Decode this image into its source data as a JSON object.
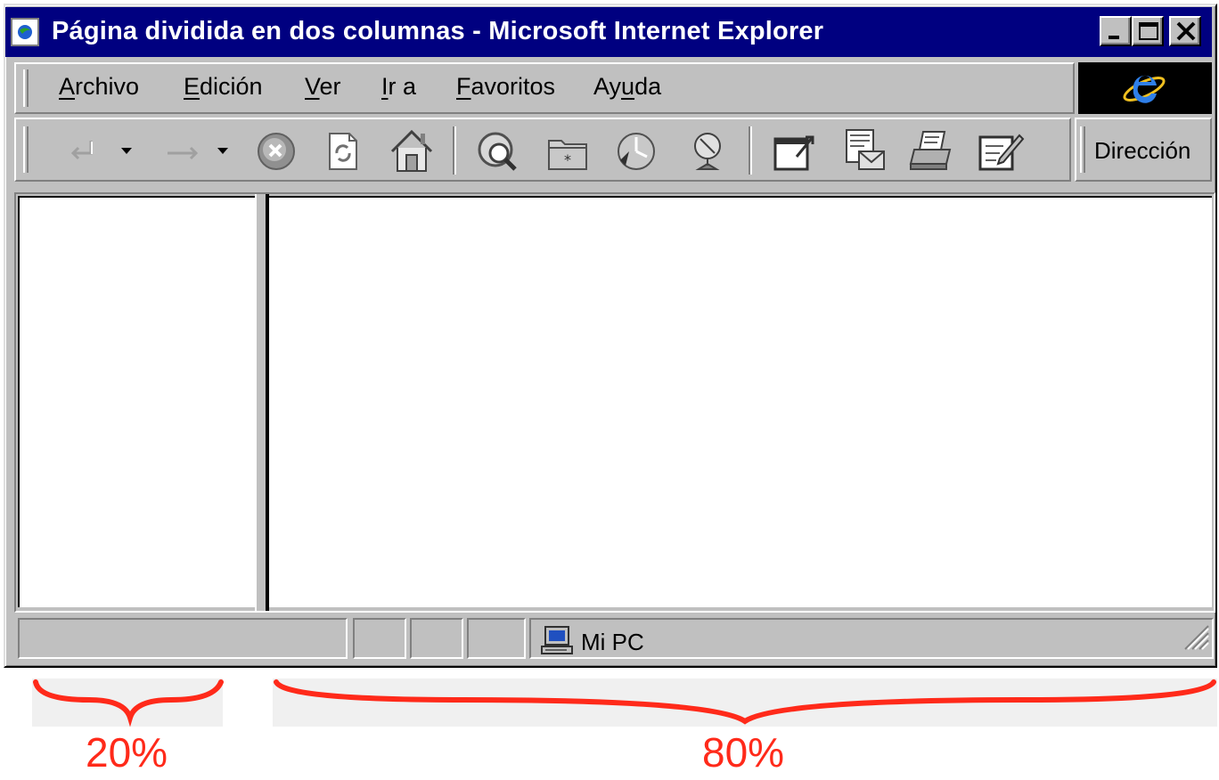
{
  "window": {
    "title": "Página dividida en dos columnas - Microsoft Internet Explorer"
  },
  "menu": {
    "items": [
      {
        "underline": "A",
        "rest": "rchivo"
      },
      {
        "underline": "E",
        "rest": "dición"
      },
      {
        "underline": "V",
        "rest": "er"
      },
      {
        "underline": "I",
        "rest": "r a"
      },
      {
        "underline": "F",
        "rest": "avoritos"
      },
      {
        "pre": "Ay",
        "underline": "u",
        "rest": "da"
      }
    ]
  },
  "toolbar": {
    "icons": [
      "back-icon",
      "forward-icon",
      "stop-icon",
      "refresh-icon",
      "home-icon",
      "search-icon",
      "favorites-icon",
      "history-icon",
      "channels-icon",
      "fullscreen-icon",
      "mail-icon",
      "print-icon",
      "edit-icon"
    ],
    "address_label": "Dirección"
  },
  "statusbar": {
    "zone_text": "Mi PC",
    "zone_icon": "computer-icon"
  },
  "annotations": {
    "left_label": "20%",
    "right_label": "80%",
    "color": "#ff2a1a"
  }
}
